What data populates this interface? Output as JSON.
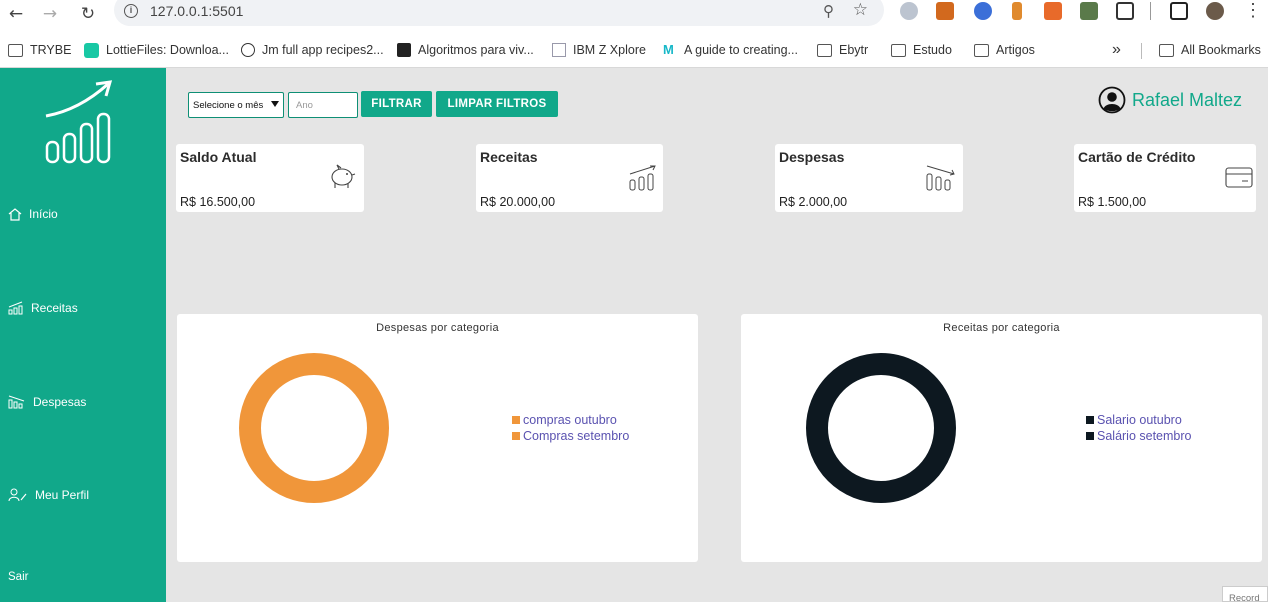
{
  "browser": {
    "url": "127.0.0.1:5501",
    "bookmarks": [
      "TRYBE",
      "LottieFiles: Downloa...",
      "Jm full app recipes2...",
      "Algoritmos para viv...",
      "IBM Z Xplore",
      "A guide to creating...",
      "Ebytr",
      "Estudo",
      "Artigos"
    ],
    "all_bookmarks": "All Bookmarks",
    "overflow": "»"
  },
  "sidebar": {
    "items": [
      {
        "label": "Início",
        "icon": "home-icon"
      },
      {
        "label": "Receitas",
        "icon": "bars-up-icon"
      },
      {
        "label": "Despesas",
        "icon": "bars-down-icon"
      },
      {
        "label": "Meu Perfil",
        "icon": "user-edit-icon"
      }
    ],
    "logout": "Sair"
  },
  "filters": {
    "month_select": "Selecione o mês",
    "year_placeholder": "Ano",
    "filter_button": "FILTRAR",
    "clear_button": "LIMPAR FILTROS"
  },
  "profile": {
    "name": "Rafael Maltez"
  },
  "cards": [
    {
      "title": "Saldo Atual",
      "value": "R$ 16.500,00",
      "icon": "piggy-bank-icon"
    },
    {
      "title": "Receitas",
      "value": "R$ 20.000,00",
      "icon": "bars-up-icon"
    },
    {
      "title": "Despesas",
      "value": "R$ 2.000,00",
      "icon": "bars-down-icon"
    },
    {
      "title": "Cartão de Crédito",
      "value": "R$ 1.500,00",
      "icon": "credit-card-icon"
    }
  ],
  "charts": {
    "expenses": {
      "title": "Despesas por categoria",
      "legend": [
        "compras outubro",
        "Compras setembro"
      ],
      "color": "#f0963a"
    },
    "income": {
      "title": "Receitas por categoria",
      "legend": [
        "Salario outubro",
        "Salário setembro"
      ],
      "color": "#0d1820"
    }
  },
  "record_tag": "Record",
  "colors": {
    "accent": "#11a88a",
    "background": "#e5e5e5"
  }
}
